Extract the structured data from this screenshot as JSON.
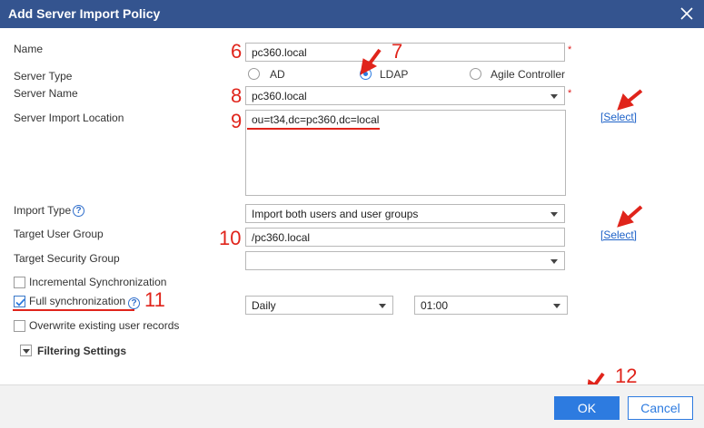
{
  "dialog": {
    "title": "Add Server Import Policy"
  },
  "form": {
    "name_label": "Name",
    "name_value": "pc360.local",
    "server_type_label": "Server Type",
    "server_type_options": [
      "AD",
      "LDAP",
      "Agile Controller"
    ],
    "server_type_selected": "LDAP",
    "server_name_label": "Server Name",
    "server_name_value": "pc360.local",
    "import_location_label": "Server Import Location",
    "import_location_value": "ou=t34,dc=pc360,dc=local",
    "select_link": "[Select]",
    "import_type_label": "Import Type",
    "import_type_value": "Import both users and user groups",
    "target_user_group_label": "Target User Group",
    "target_user_group_value": "/pc360.local",
    "target_security_group_label": "Target Security Group",
    "target_security_group_value": "",
    "incremental_sync_label": "Incremental Synchronization",
    "incremental_sync_checked": false,
    "full_sync_label": "Full synchronization",
    "full_sync_checked": true,
    "full_sync_frequency": "Daily",
    "full_sync_time": "01:00",
    "overwrite_label": "Overwrite existing user records",
    "overwrite_checked": false,
    "filtering_label": "Filtering Settings"
  },
  "annotations": {
    "n6": "6",
    "n7": "7",
    "n8": "8",
    "n9": "9",
    "n10": "10",
    "n11": "11",
    "n12": "12"
  },
  "footer": {
    "ok_label": "OK",
    "cancel_label": "Cancel"
  },
  "colors": {
    "titlebar": "#34548f",
    "accent": "#2d7be0",
    "annotation": "#e0241b",
    "required": "#e02020"
  }
}
